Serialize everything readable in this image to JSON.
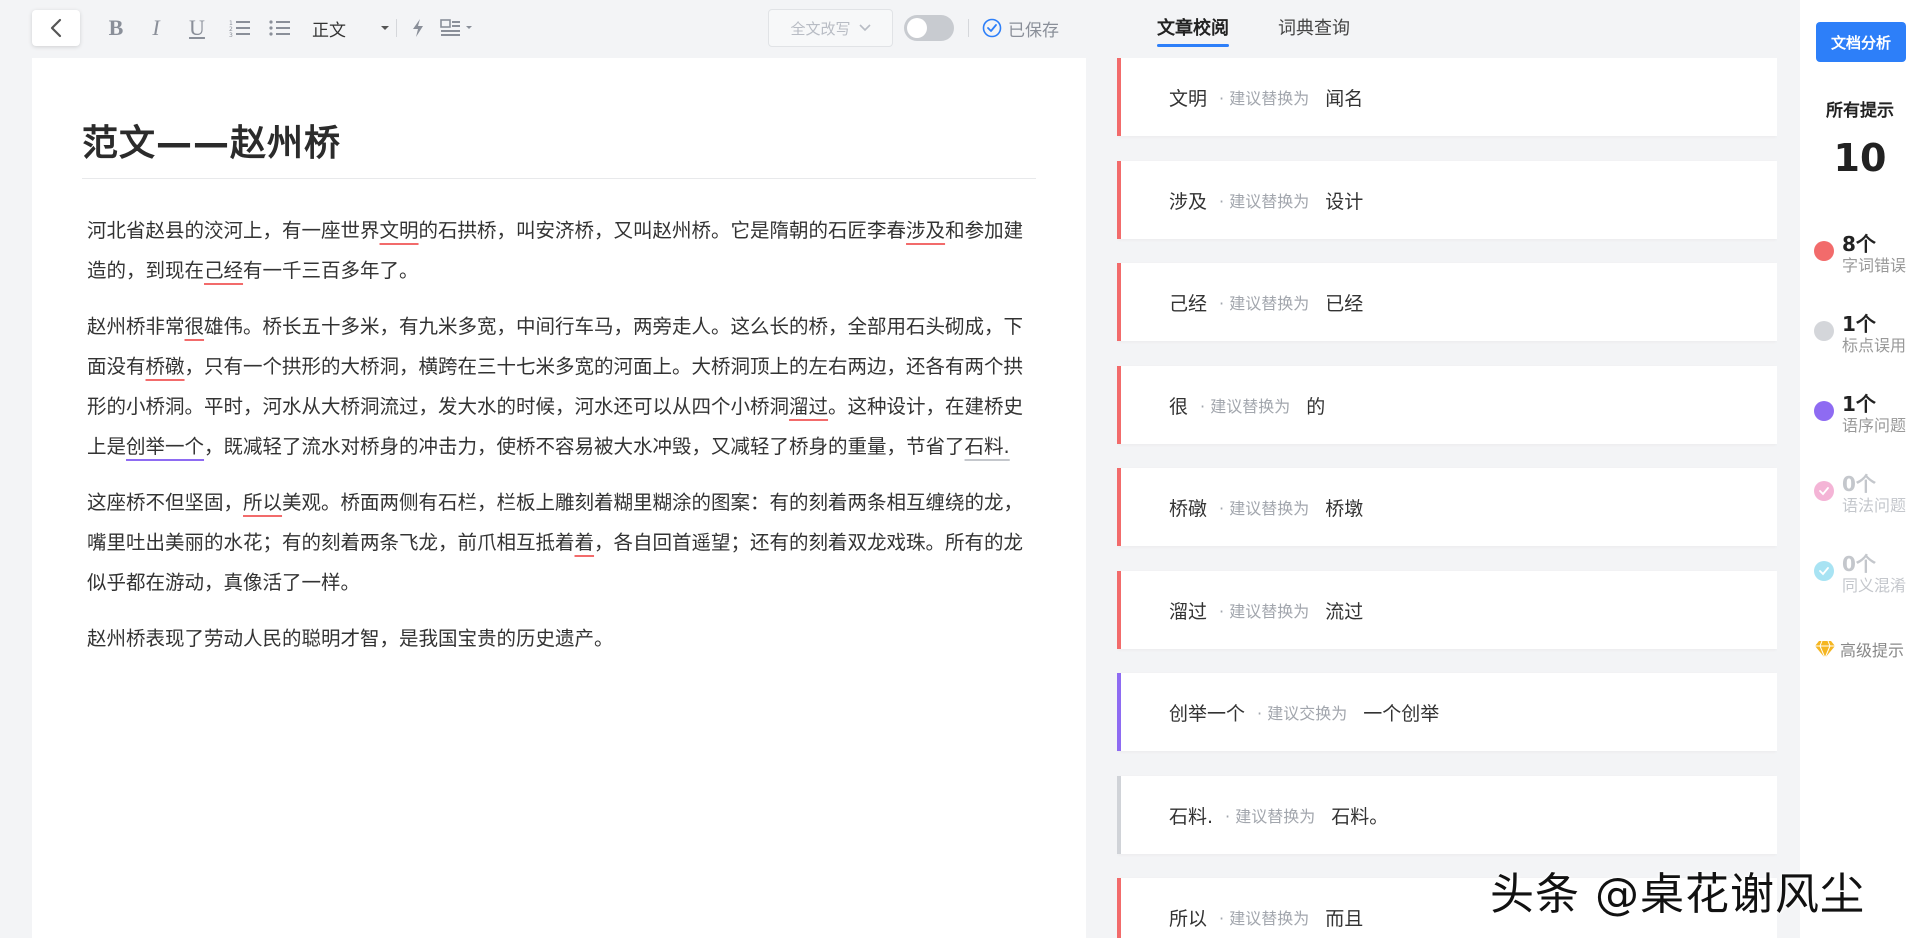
{
  "toolbar": {
    "style_select": "正文",
    "rewrite_label": "全文改写",
    "saved_label": "已保存"
  },
  "tabs": [
    {
      "label": "文章校阅",
      "active": true
    },
    {
      "label": "词典查询",
      "active": false
    }
  ],
  "document": {
    "title": "范文——赵州桥",
    "paragraphs": [
      [
        {
          "t": "河北省赵县的洨河上，有一座世界"
        },
        {
          "t": "文明",
          "m": "red"
        },
        {
          "t": "的石拱桥，叫安济桥，又叫赵州桥。它是隋朝的石匠李春"
        },
        {
          "t": "涉及",
          "m": "red"
        },
        {
          "t": "和参加建造的，到现在"
        },
        {
          "t": "己经",
          "m": "red"
        },
        {
          "t": "有一千三百多年了。"
        }
      ],
      [
        {
          "t": "赵州桥非常"
        },
        {
          "t": "很",
          "m": "red"
        },
        {
          "t": "雄伟。桥长五十多米，有九米多宽，中间行车马，两旁走人。这么长的桥，全部用石头砌成，下面没有"
        },
        {
          "t": "桥礅",
          "m": "red"
        },
        {
          "t": "，只有一个拱形的大桥洞，横跨在三十七米多宽的河面上。大桥洞顶上的左右两边，还各有两个拱形的小桥洞。平时，河水从大桥洞流过，发大水的时候，河水还可以从四个小桥洞"
        },
        {
          "t": "溜过",
          "m": "red"
        },
        {
          "t": "。这种设计，在建桥史上是"
        },
        {
          "t": "创举一个",
          "m": "purple"
        },
        {
          "t": "，既减轻了流水对桥身的冲击力，使桥不容易被大水冲毁，又减轻了桥身的重量，节省了"
        },
        {
          "t": "石料.",
          "m": "gray"
        }
      ],
      [
        {
          "t": "这座桥不但坚固，"
        },
        {
          "t": "所以",
          "m": "red"
        },
        {
          "t": "美观。桥面两侧有石栏，栏板上雕刻着糊里糊涂的图案：有的刻着两条相互缠绕的龙，嘴里吐出美丽的水花；有的刻着两条飞龙，前爪相互抵着"
        },
        {
          "t": "着",
          "m": "red"
        },
        {
          "t": "，各自回首遥望；还有的刻着双龙戏珠。所有的龙似乎都在游动，真像活了一样。"
        }
      ],
      [
        {
          "t": "赵州桥表现了劳动人民的聪明才智，是我国宝贵的历史遗产。"
        }
      ]
    ]
  },
  "suggestions": [
    {
      "original": "文明",
      "hint": "· 建议替换为",
      "replacement": "闻名",
      "type": "red"
    },
    {
      "original": "涉及",
      "hint": "· 建议替换为",
      "replacement": "设计",
      "type": "red"
    },
    {
      "original": "己经",
      "hint": "· 建议替换为",
      "replacement": "已经",
      "type": "red"
    },
    {
      "original": "很",
      "hint": "· 建议替换为",
      "replacement": "的",
      "type": "red"
    },
    {
      "original": "桥礅",
      "hint": "· 建议替换为",
      "replacement": "桥墩",
      "type": "red"
    },
    {
      "original": "溜过",
      "hint": "· 建议替换为",
      "replacement": "流过",
      "type": "red"
    },
    {
      "original": "创举一个",
      "hint": "· 建议交换为",
      "replacement": "一个创举",
      "type": "purple"
    },
    {
      "original": "石料.",
      "hint": "· 建议替换为",
      "replacement": "石料。",
      "type": "gray"
    },
    {
      "original": "所以",
      "hint": "· 建议替换为",
      "replacement": "而且",
      "type": "red"
    }
  ],
  "right_panel": {
    "analysis_button": "文档分析",
    "all_label": "所有提示",
    "all_count": "10",
    "stats": [
      {
        "count": "8个",
        "label": "字词错误",
        "color": "#f26b6b",
        "dim": false
      },
      {
        "count": "1个",
        "label": "标点误用",
        "color": "#d4d6da",
        "dim": false
      },
      {
        "count": "1个",
        "label": "语序问题",
        "color": "#8e6bf2",
        "dim": false
      },
      {
        "count": "0个",
        "label": "语法问题",
        "color": "#f4b4d6",
        "dim": true
      },
      {
        "count": "0个",
        "label": "同义混淆",
        "color": "#a8e3f3",
        "dim": true
      }
    ],
    "premium_label": "高级提示"
  },
  "watermark": "头条 @桌花谢风尘",
  "colors": {
    "accent": "#2d7ff9",
    "error_red": "#f26b6b",
    "order_purple": "#8e6bf2",
    "punct_gray": "#d0d3d8"
  }
}
